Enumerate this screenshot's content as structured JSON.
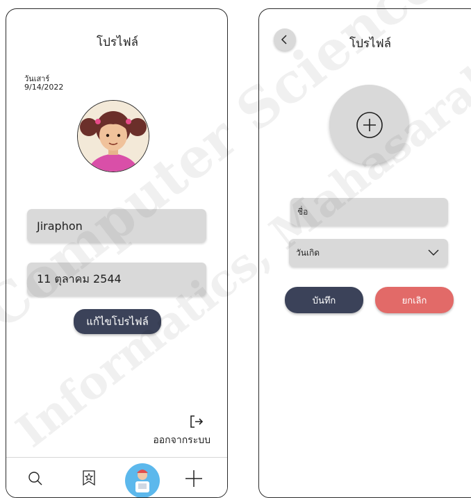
{
  "left_screen": {
    "title": "โปรไฟล์",
    "day_name": "วันเสาร์",
    "date": "9/14/2022",
    "name_value": "Jiraphon",
    "birthdate_value": "11 ตุลาคม 2544",
    "edit_button_label": "แก้ไขโปรไฟล์",
    "logout_label": "ออกจากระบบ",
    "bottom_nav": [
      "search-icon",
      "star-bookmark-icon",
      "profile-avatar",
      "plus-icon"
    ]
  },
  "right_screen": {
    "title": "โปรไฟล์",
    "name_placeholder": "ชื่อ",
    "birthdate_placeholder": "วันเกิด",
    "save_label": "บันทึก",
    "cancel_label": "ยกเลิก"
  },
  "watermark": {
    "line1": "Computer Science, Mahasarakham",
    "line2": "Informatics, Mahasarakham"
  },
  "colors": {
    "dark_button": "#3b4259",
    "cancel_button": "#e26a68",
    "field_gray": "#d9d9d9",
    "nav_active": "#5cb8ec"
  }
}
